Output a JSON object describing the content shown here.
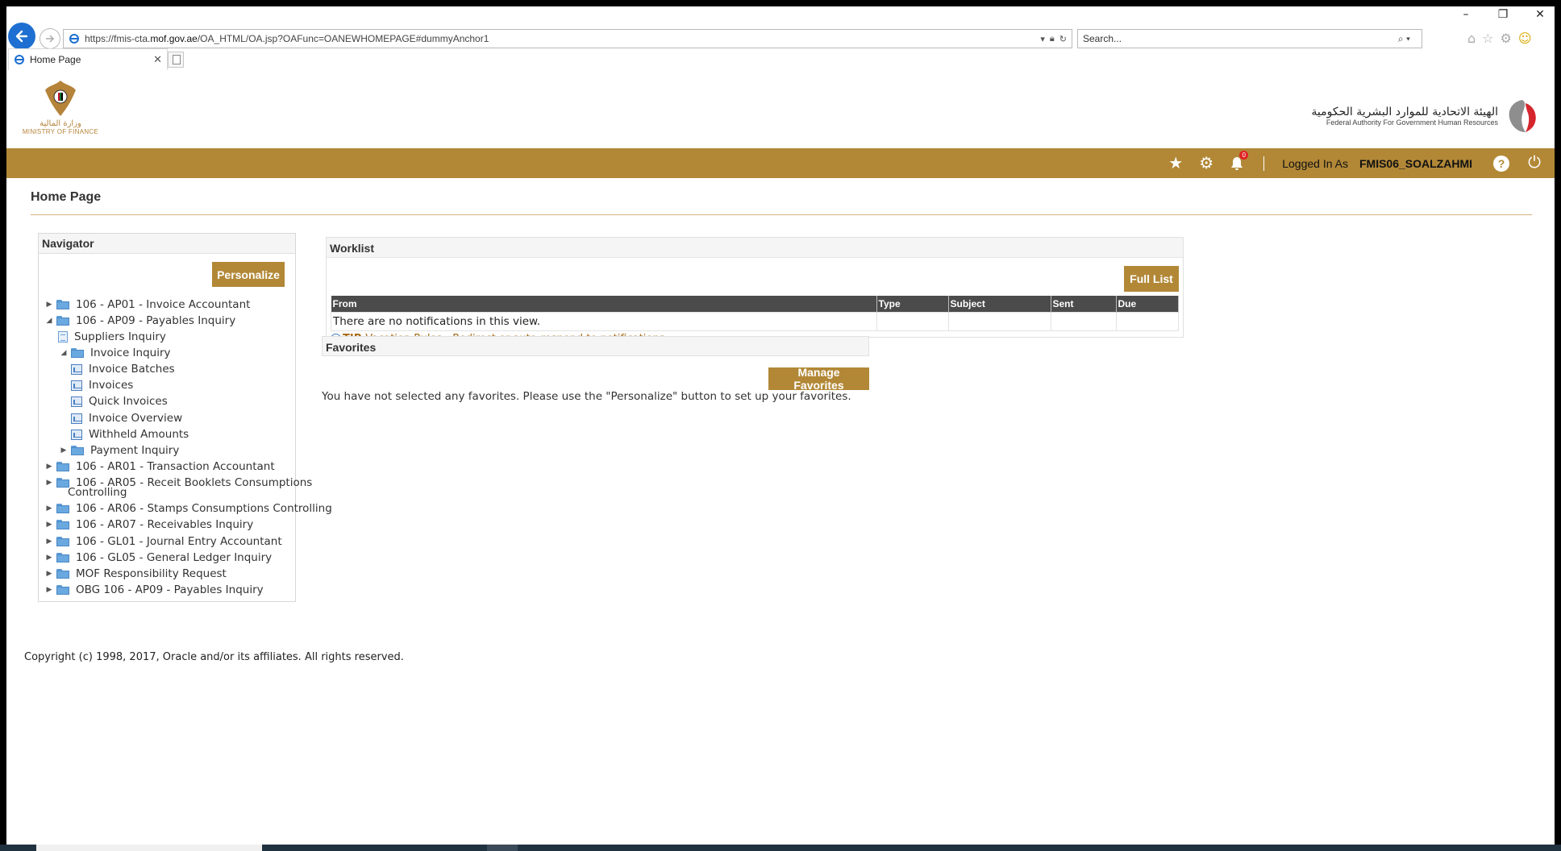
{
  "browser": {
    "url_prefix": "https://fmis-cta.",
    "url_domain": "mof.gov.ae",
    "url_path": "/OA_HTML/OA.jsp?OAFunc=OANEWHOMEPAGE#dummyAnchor1",
    "search_placeholder": "Search...",
    "tab_title": "Home Page"
  },
  "header": {
    "left_logo_ar": "وزارة المالية",
    "left_logo_en": "MINISTRY OF FINANCE",
    "right_logo_ar": "الهيئة الاتحادية للموارد البشرية الحكومية",
    "right_logo_en": "Federal Authority For Government Human Resources",
    "notifications_count": "0",
    "logged_in_label": "Logged In As",
    "username": "FMIS06_SOALZAHMI",
    "help_label": "?"
  },
  "page": {
    "title": "Home Page"
  },
  "navigator": {
    "title": "Navigator",
    "personalize_label": "Personalize",
    "items": [
      {
        "label": "106 - AP01 - Invoice Accountant"
      },
      {
        "label": "106 - AP09 - Payables Inquiry"
      },
      {
        "label": "Suppliers Inquiry"
      },
      {
        "label": "Invoice Inquiry"
      },
      {
        "label": "Invoice Batches"
      },
      {
        "label": "Invoices"
      },
      {
        "label": "Quick Invoices"
      },
      {
        "label": "Invoice Overview"
      },
      {
        "label": "Withheld Amounts"
      },
      {
        "label": "Payment Inquiry"
      },
      {
        "label": "106 - AR01 - Transaction Accountant"
      },
      {
        "label": "106 - AR05 - Receit Booklets Consumptions"
      },
      {
        "label": "Controlling"
      },
      {
        "label": "106 - AR06 - Stamps Consumptions Controlling"
      },
      {
        "label": "106 - AR07 - Receivables Inquiry"
      },
      {
        "label": "106 - GL01 - Journal Entry Accountant"
      },
      {
        "label": "106 - GL05 - General Ledger Inquiry"
      },
      {
        "label": "MOF Responsibility Request"
      },
      {
        "label": "OBG 106 - AP09 - Payables Inquiry"
      }
    ]
  },
  "worklist": {
    "title": "Worklist",
    "full_list_label": "Full List",
    "columns": [
      "From",
      "Type",
      "Subject",
      "Sent",
      "Due"
    ],
    "empty_message": "There are no notifications in this view.",
    "tip_label": "TIP",
    "tip_link": "Vacation Rules - Redirect or auto-respond to notifications."
  },
  "favorites": {
    "title": "Favorites",
    "manage_label": "Manage Favorites",
    "message": "You have not selected any favorites. Please use the \"Personalize\" button to set up your favorites."
  },
  "footer": {
    "copyright": "Copyright (c) 1998, 2017, Oracle and/or its affiliates. All rights reserved."
  },
  "colors": {
    "gold": "#b28837",
    "link": "#a66a16",
    "header_dark": "#4b4b4b"
  }
}
